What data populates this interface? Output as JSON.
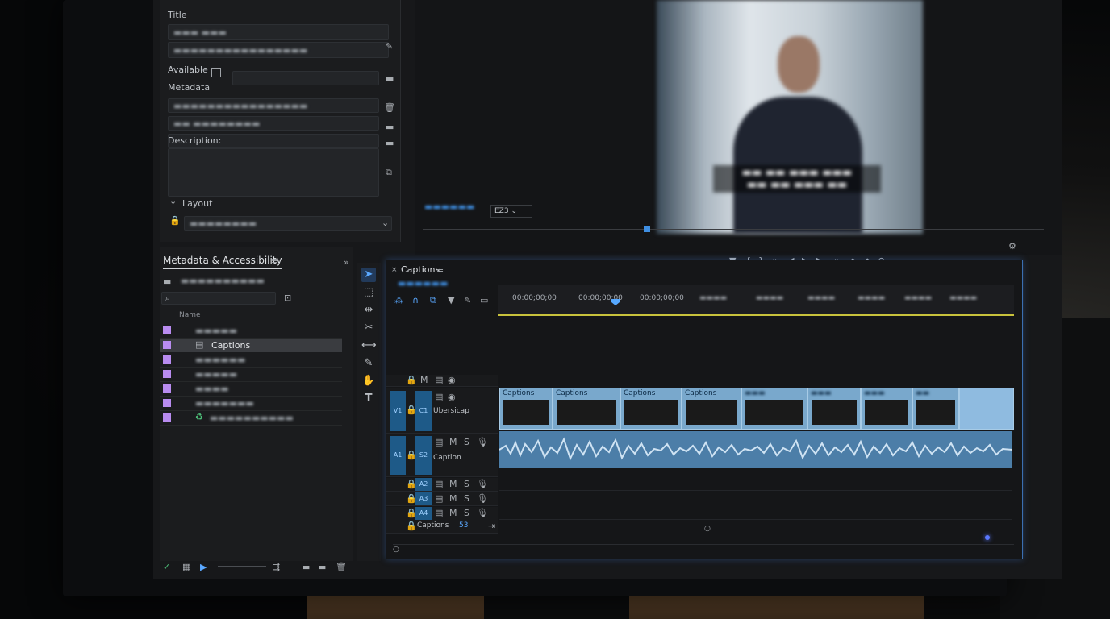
{
  "metadata_panel": {
    "title_label": "Title",
    "available_label": "Available",
    "metadata_label": "Metadata",
    "description_label": "Description:",
    "layout_label": "Layout"
  },
  "project_panel": {
    "tab_label": "Metadata & Accessibility",
    "column_name": "Name",
    "items": [
      {
        "label": "Captions",
        "color": "#b98cf0"
      }
    ]
  },
  "program_monitor": {
    "zoom": "EZ3"
  },
  "timeline": {
    "tab_label": "Captions",
    "timecodes": [
      "00:00;00;00",
      "00:00;00;00",
      "00:00;00;00"
    ],
    "tracks": {
      "caption_track_label": "Ubersicap",
      "audio_track_label": "Caption",
      "bottom_label": "Captions",
      "bottom_count": "53"
    },
    "caption_clips": [
      "Captions",
      "Captions",
      "Captions",
      "Captions"
    ],
    "colors": {
      "accent": "#3f8fe3",
      "clip": "#79a8cc",
      "work_area": "#c8c23c"
    }
  }
}
